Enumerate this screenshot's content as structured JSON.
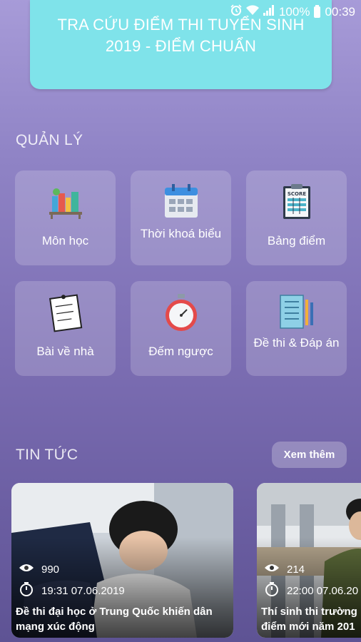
{
  "status_bar": {
    "battery": "100%",
    "time": "00:39"
  },
  "banner": {
    "title": "TRA CỨU ĐIỂM THI TUYỂN SINH 2019 - ĐIỂM CHUẨN"
  },
  "manage": {
    "title": "QUẢN LÝ",
    "items": [
      {
        "label": "Môn học",
        "icon": "books-icon"
      },
      {
        "label": "Thời khoá biểu",
        "icon": "calendar-icon"
      },
      {
        "label": "Bảng điểm",
        "icon": "score-board-icon"
      },
      {
        "label": "Bài về nhà",
        "icon": "homework-icon"
      },
      {
        "label": "Đếm ngược",
        "icon": "stopwatch-icon"
      },
      {
        "label": "Đề thi & Đáp án",
        "icon": "exam-answers-icon"
      }
    ]
  },
  "news": {
    "title": "TIN TỨC",
    "more_label": "Xem thêm",
    "items": [
      {
        "views": "990",
        "date": "19:31 07.06.2019",
        "headline": "Đề thi đại học ở Trung Quốc khiến dân mạng xúc động"
      },
      {
        "views": "214",
        "date": "22:00 07.06.20",
        "headline": "Thí sinh thi trường điểm mới năm 201"
      }
    ]
  },
  "colors": {
    "banner": "#7fe3ea",
    "accent": "#8f83c5"
  }
}
